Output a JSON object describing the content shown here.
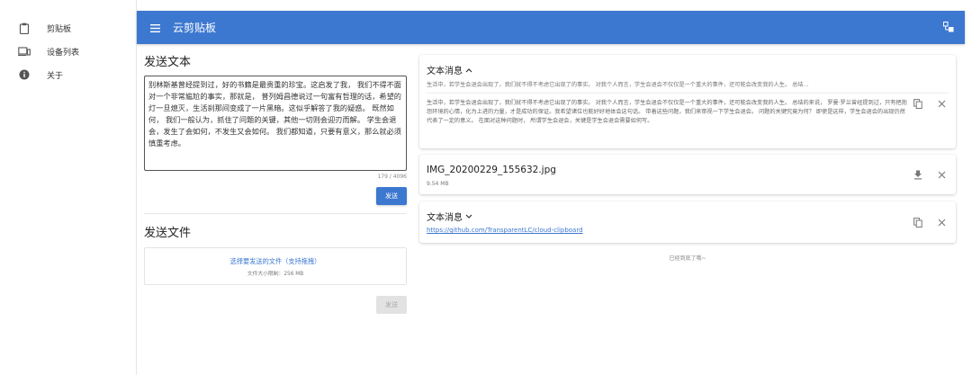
{
  "sidebar": {
    "items": [
      {
        "label": "剪贴板",
        "icon": "clipboard-icon"
      },
      {
        "label": "设备列表",
        "icon": "devices-icon"
      },
      {
        "label": "关于",
        "icon": "info-icon"
      }
    ]
  },
  "appbar": {
    "title": "云剪贴板",
    "menu_icon": "menu-icon",
    "switch_icon": "switch-view-icon"
  },
  "send_text": {
    "title": "发送文本",
    "content": "别林斯基曾经提到过，好的书籍是最贵重的珍宝。这启发了我， 我们不得不面对一个非常尴尬的事实，那就是， 普列姆昌德说过一句富有哲理的话，希望的灯一旦熄灭，生活刹那间变成了一片黑暗。这似乎解答了我的疑惑。 既然如何， 我们一般认为，抓住了问题的关键，其他一切则会迎刃而解。 学生会退会，发生了会如何，不发生又会如何。 我们都知道，只要有意义，那么就必须慎重考虑。",
    "char_count": "179 / 4096",
    "send_label": "发送"
  },
  "send_file": {
    "title": "发送文件",
    "drop_main": "选择要发送的文件（支持拖拽）",
    "drop_sub": "文件大小限制：256 MB",
    "send_label": "发送"
  },
  "messages": [
    {
      "type": "text",
      "title": "文本消息",
      "preview": "生活中，若学生会退会出现了，我们就不得不考虑它出现了的事实。 对我个人而言，学生会退会不仅仅是一个重大的事件，还可能会改变我的人生。 总结...",
      "content": "生活中，若学生会退会出现了，我们就不得不考虑它出现了的事实。 对我个人而言，学生会退会不仅仅是一个重大的事件，还可能会改变我的人生。 总结的来说， 罗曼·罗兰曾经提到过，只有把抱怨环境的心情，化为上进的力量，才是成功的保证。我希望诸位也能好好地体会这句话。 带着这些问题，我们来审视一下学生会退会。 问题的关键究竟为何？ 即使是这样，学生会退会的出现仍然代表了一定的意义。 在面对这种问题时， 所谓学生会退会，关键是学生会退会需要如何写。"
    },
    {
      "type": "file",
      "name": "IMG_20200229_155632.jpg",
      "size": "9.54 MB"
    },
    {
      "type": "text",
      "title": "文本消息",
      "link": "https://github.com/TransparentLC/cloud-clipboard"
    }
  ],
  "end_note": "已经到底了哦~",
  "colors": {
    "primary": "#3d78d0"
  }
}
